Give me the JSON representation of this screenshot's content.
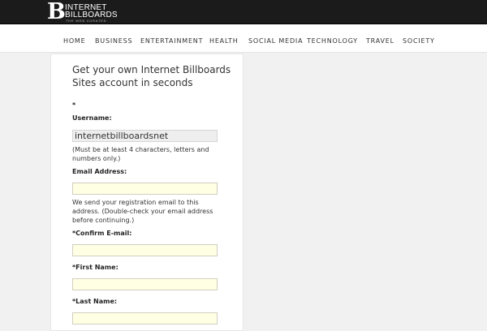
{
  "brand": {
    "name_line1": "INTERNET",
    "name_line2": "BILLBOARDS",
    "tagline": "THE WEB CURATED",
    "logo_letter": "B"
  },
  "nav": {
    "items": [
      "Home",
      "Business",
      "Entertainment",
      "Health",
      "Social Media",
      "Technology",
      "Travel",
      "Society"
    ]
  },
  "form": {
    "heading": "Get your own Internet Billboards Sites account in seconds",
    "required_marker": "*",
    "username": {
      "label": "Username:",
      "value": "internetbillboardsnet",
      "hint": "(Must be at least 4 characters, letters and numbers only.)"
    },
    "email": {
      "label": "Email Address:",
      "value": "",
      "hint": "We send your registration email to this address. (Double-check your email address before continuing.)"
    },
    "confirm_email": {
      "label": "*Confirm E-mail:",
      "value": ""
    },
    "first_name": {
      "label": "*First Name:",
      "value": ""
    },
    "last_name": {
      "label": "*Last Name:",
      "value": ""
    }
  },
  "colors": {
    "header_bg": "#1b1b1b",
    "input_bg": "#ffffe4",
    "page_bg": "#f1f1f1"
  }
}
